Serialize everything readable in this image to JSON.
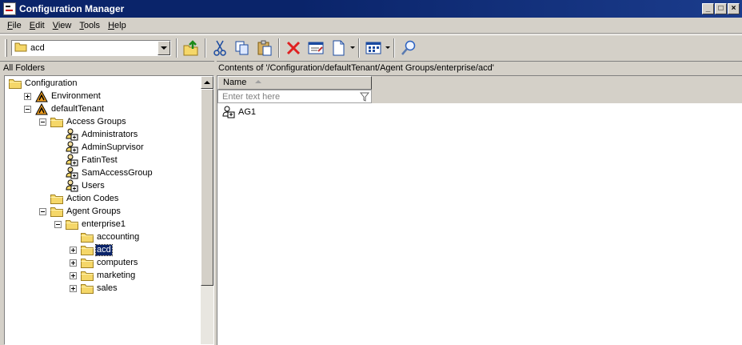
{
  "window": {
    "title": "Configuration Manager"
  },
  "menu": [
    {
      "label": "File",
      "key": "F",
      "rest": "ile"
    },
    {
      "label": "Edit",
      "key": "E",
      "rest": "dit"
    },
    {
      "label": "View",
      "key": "V",
      "rest": "iew"
    },
    {
      "label": "Tools",
      "key": "T",
      "rest": "ools"
    },
    {
      "label": "Help",
      "key": "H",
      "rest": "elp"
    }
  ],
  "toolbar": {
    "location_value": "acd"
  },
  "left_panel": {
    "header": "All Folders"
  },
  "right_panel": {
    "header": "Contents of '/Configuration/defaultTenant/Agent Groups/enterprise/acd'",
    "column_name": "Name",
    "filter_placeholder": "Enter text here",
    "items": [
      {
        "label": "AG1",
        "icon": "agent-group-icon"
      }
    ]
  },
  "tree": [
    {
      "label": "Configuration",
      "level": 0,
      "expander": "none",
      "icon": "folder",
      "selected": false
    },
    {
      "label": "Environment",
      "level": 1,
      "expander": "plus",
      "icon": "tenant",
      "selected": false
    },
    {
      "label": "defaultTenant",
      "level": 1,
      "expander": "minus",
      "icon": "tenant",
      "selected": false
    },
    {
      "label": "Access Groups",
      "level": 2,
      "expander": "minus",
      "icon": "folder",
      "selected": false
    },
    {
      "label": "Administrators",
      "level": 3,
      "expander": "none",
      "icon": "access-group",
      "selected": false
    },
    {
      "label": "AdminSuprvisor",
      "level": 3,
      "expander": "none",
      "icon": "access-group",
      "selected": false
    },
    {
      "label": "FatinTest",
      "level": 3,
      "expander": "none",
      "icon": "access-group",
      "selected": false
    },
    {
      "label": "SamAccessGroup",
      "level": 3,
      "expander": "none",
      "icon": "access-group",
      "selected": false
    },
    {
      "label": "Users",
      "level": 3,
      "expander": "none",
      "icon": "access-group",
      "selected": false
    },
    {
      "label": "Action Codes",
      "level": 2,
      "expander": "none",
      "icon": "folder",
      "selected": false
    },
    {
      "label": "Agent Groups",
      "level": 2,
      "expander": "minus",
      "icon": "folder",
      "selected": false
    },
    {
      "label": "enterprise1",
      "level": 3,
      "expander": "minus",
      "icon": "folder",
      "selected": false
    },
    {
      "label": "accounting",
      "level": 4,
      "expander": "none",
      "icon": "folder",
      "selected": false
    },
    {
      "label": "acd",
      "level": 4,
      "expander": "plus",
      "icon": "folder",
      "selected": true
    },
    {
      "label": "computers",
      "level": 4,
      "expander": "plus",
      "icon": "folder",
      "selected": false
    },
    {
      "label": "marketing",
      "level": 4,
      "expander": "plus",
      "icon": "folder",
      "selected": false
    },
    {
      "label": "sales",
      "level": 4,
      "expander": "plus",
      "icon": "folder",
      "selected": false
    }
  ],
  "colors": {
    "titlebar": "#0a246a",
    "chrome": "#d4d0c8",
    "selection": "#0a246a",
    "folder": "#f5d769",
    "delete": "#e02020"
  }
}
